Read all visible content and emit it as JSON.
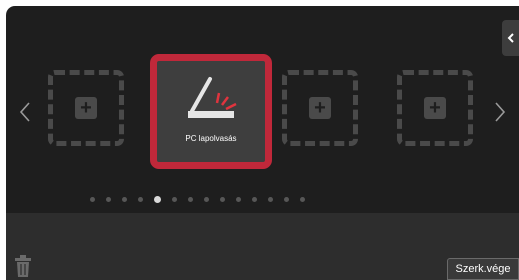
{
  "home_screen": {
    "selected_shortcut": {
      "label": "PC lapolvasás",
      "icon": "pc-scan-icon"
    },
    "empty_slots": [
      {
        "icon": "plus-icon"
      },
      {
        "icon": "plus-icon"
      },
      {
        "icon": "plus-icon"
      }
    ],
    "page_indicator": {
      "total_pages": 14,
      "current_page": 5
    }
  },
  "toolbar": {
    "done_label": "Szerk.vége",
    "trash_icon": "trash-icon",
    "collapse_icon": "chevron-left-icon"
  },
  "colors": {
    "selection_border": "#c0283a",
    "background": "#1e1e1e",
    "footer": "#2d2d2d"
  }
}
